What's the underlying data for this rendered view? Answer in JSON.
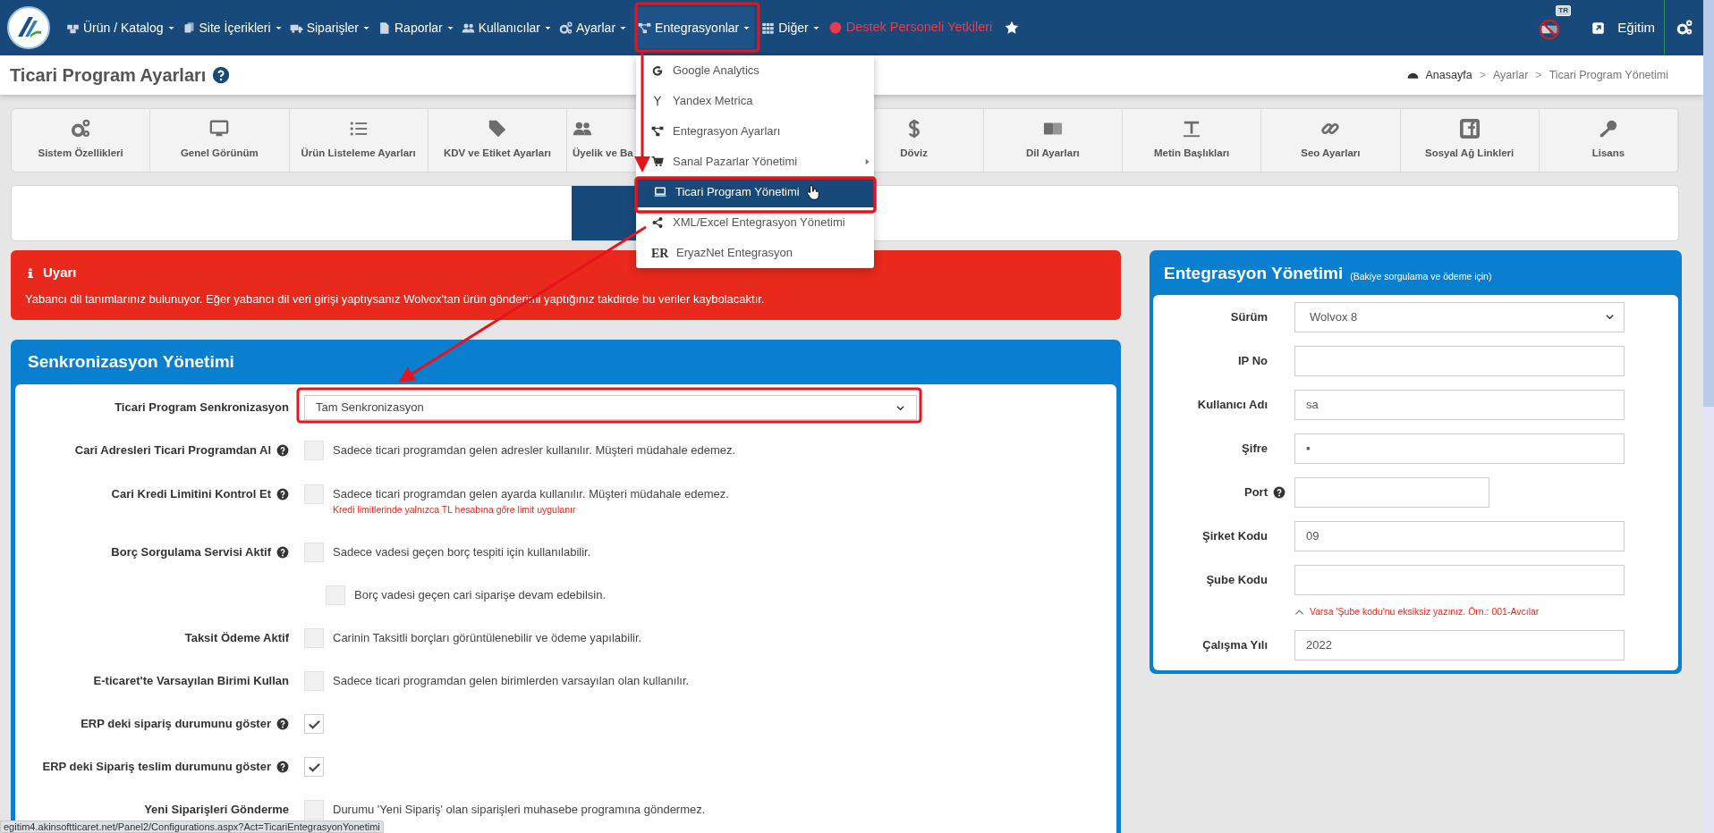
{
  "nav": {
    "items": [
      {
        "label": "Ürün / Katalog",
        "selected": false
      },
      {
        "label": "Site İçerikleri",
        "selected": false
      },
      {
        "label": "Siparişler",
        "selected": false
      },
      {
        "label": "Raporlar",
        "selected": false
      },
      {
        "label": "Kullanıcılar",
        "selected": false
      },
      {
        "label": "Ayarlar",
        "selected": false
      },
      {
        "label": "Entegrasyonlar",
        "selected": true
      },
      {
        "label": "Diğer",
        "selected": false
      }
    ],
    "support": "Destek Personeli Yetkileri",
    "lang_badge": "TR",
    "user": "Eğitim"
  },
  "dropdown": {
    "items": [
      {
        "label": "Google Analytics",
        "selected": false,
        "submenu": false
      },
      {
        "label": "Yandex Metrica",
        "selected": false,
        "submenu": false
      },
      {
        "label": "Entegrasyon Ayarları",
        "selected": false,
        "submenu": false
      },
      {
        "label": "Sanal Pazarlar Yönetimi",
        "selected": false,
        "submenu": true
      },
      {
        "label": "Ticari Program Yönetimi",
        "selected": true,
        "submenu": false
      },
      {
        "label": "XML/Excel Entegrasyon Yönetimi",
        "selected": false,
        "submenu": false
      },
      {
        "label": "EryazNet Entegrasyon",
        "selected": false,
        "submenu": false,
        "icon_text": "ER"
      }
    ]
  },
  "page_title": "Ticari Program Ayarları",
  "breadcrumb": {
    "items": [
      "Anasayfa",
      "Ayarlar",
      "Ticari Program Yönetimi"
    ],
    "separator": ">"
  },
  "settings_tabs": [
    {
      "label": "Sistem Özellikleri",
      "cut": false
    },
    {
      "label": "Genel Görünüm",
      "cut": false
    },
    {
      "label": "Ürün Listeleme Ayarları",
      "cut": false
    },
    {
      "label": "KDV ve Etiket Ayarları",
      "cut": false
    },
    {
      "label": "Üyelik ve Ba",
      "cut": true
    },
    {
      "label": "Döviz",
      "cut": false
    },
    {
      "label": "Dil Ayarları",
      "cut": false
    },
    {
      "label": "Metin Başlıkları",
      "cut": false
    },
    {
      "label": "Seo Ayarları",
      "cut": false
    },
    {
      "label": "Sosyal Ağ Linkleri",
      "cut": false
    },
    {
      "label": "Lisans",
      "cut": false
    }
  ],
  "alert": {
    "title": "Uyarı",
    "message": "Yabancı dil tanımlarınız bulunuyor. Eğer yabancı dil veri girişi yaptıysanız Wolvox'tan ürün gönderimi yaptığınız takdirde bu veriler kaybolacaktır."
  },
  "sync_panel": {
    "title": "Senkronizasyon Yönetimi",
    "rows": [
      {
        "kind": "select",
        "label": "Ticari Program Senkronizasyon",
        "value": "Tam Senkronizasyon"
      },
      {
        "kind": "checkbox",
        "label": "Cari Adresleri Ticari Programdan Al",
        "help": true,
        "checked": false,
        "disabled": true,
        "description": "Sadece ticari programdan gelen adresler kullanılır. Müşteri müdahale edemez."
      },
      {
        "kind": "checkbox",
        "label": "Cari Kredi Limitini Kontrol Et",
        "help": true,
        "checked": false,
        "disabled": true,
        "description": "Sadece ticari programdan gelen ayarda kullanılır. Müşteri müdahale edemez.",
        "note": "Kredi limitlerinde yalnızca TL hesabına göre limit uygulanır"
      },
      {
        "kind": "checkbox",
        "label": "Borç Sorgulama Servisi Aktif",
        "help": true,
        "checked": false,
        "disabled": true,
        "description": "Sadece vadesi geçen borç tespiti için kullanılabilir."
      },
      {
        "kind": "sub_checkbox",
        "checked": false,
        "disabled": true,
        "description": "Borç vadesi geçen cari siparişe devam edebilsin."
      },
      {
        "kind": "checkbox",
        "label": "Taksit Ödeme Aktif",
        "help": false,
        "checked": false,
        "disabled": true,
        "description": "Carinin Taksitli borçları görüntülenebilir ve ödeme yapılabilir."
      },
      {
        "kind": "checkbox",
        "label": "E-ticaret'te Varsayılan Birimi Kullan",
        "help": false,
        "checked": false,
        "disabled": true,
        "description": "Sadece ticari programdan gelen birimlerden varsayılan olan kullanılır."
      },
      {
        "kind": "checkbox",
        "label": "ERP deki sipariş durumunu göster",
        "help": true,
        "checked": true,
        "disabled": false
      },
      {
        "kind": "checkbox",
        "label": "ERP deki Sipariş teslim durumunu göster",
        "help": true,
        "checked": true,
        "disabled": false
      },
      {
        "kind": "checkbox",
        "label": "Yeni Siparişleri Gönderme",
        "help": false,
        "checked": false,
        "disabled": true,
        "description": "Durumu 'Yeni Sipariş' olan siparişleri muhasebe programına göndermez."
      }
    ]
  },
  "integration_panel": {
    "title": "Entegrasyon Yönetimi",
    "subtitle": "(Bakiye sorgulama ve ödeme için)",
    "fields": [
      {
        "kind": "select",
        "label": "Sürüm",
        "value": "Wolvox 8"
      },
      {
        "kind": "text",
        "label": "IP No"
      },
      {
        "kind": "text",
        "label": "Kullanıcı Adı",
        "value": "sa"
      },
      {
        "kind": "text",
        "label": "Şifre",
        "value": "▪"
      },
      {
        "kind": "text",
        "label": "Port",
        "help": true,
        "short": true
      },
      {
        "kind": "text",
        "label": "Şirket Kodu",
        "value": "09"
      },
      {
        "kind": "text",
        "label": "Şube Kodu",
        "hint": "Varsa 'Şube kodu'nu eksiksiz yazınız. Örn.: 001-Avcılar"
      },
      {
        "kind": "text",
        "label": "Çalışma Yılı",
        "value": "2022"
      }
    ]
  },
  "status_bar": {
    "url": "egitim4.akinsoftticaret.net/Panel2/Configurations.aspx?Act=TicariEntegrasyonYonetimi"
  }
}
